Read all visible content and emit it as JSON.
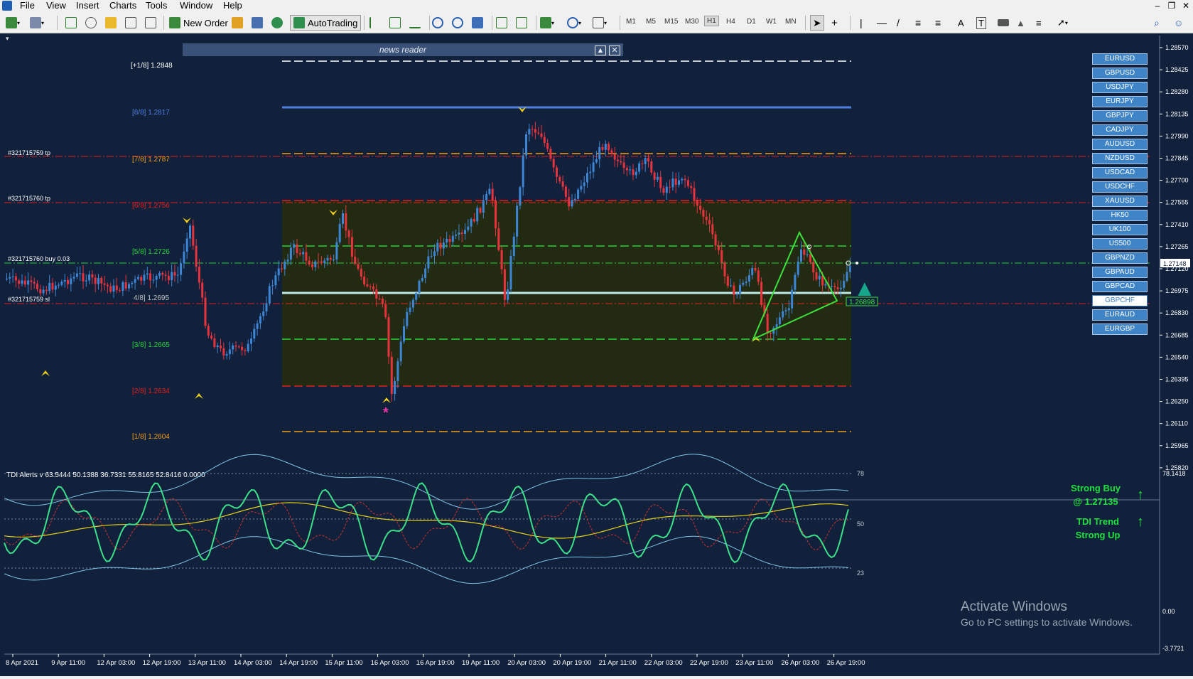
{
  "menu": [
    "File",
    "View",
    "Insert",
    "Charts",
    "Tools",
    "Window",
    "Help"
  ],
  "toolbar": {
    "new_order": "New Order",
    "autotrading": "AutoTrading"
  },
  "timeframes": [
    "M1",
    "M5",
    "M15",
    "M30",
    "H1",
    "H4",
    "D1",
    "W1",
    "MN"
  ],
  "active_timeframe": "H1",
  "news_reader": {
    "title": "news reader"
  },
  "price_axis": [
    "1.28570",
    "1.28425",
    "1.28280",
    "1.28135",
    "1.27990",
    "1.27845",
    "1.27700",
    "1.27555",
    "1.27410",
    "1.27265",
    "1.27120",
    "1.26975",
    "1.26830",
    "1.26685",
    "1.26540",
    "1.26395",
    "1.26250",
    "1.26110",
    "1.25965",
    "1.25820"
  ],
  "current_price": "1.27148",
  "murrey_levels": [
    {
      "label": "[+1/8]",
      "value": "1.2848",
      "color": "#ffffff"
    },
    {
      "label": "[8/8]",
      "value": "1.2817",
      "color": "#4e7fe0"
    },
    {
      "label": "[7/8]",
      "value": "1.2787",
      "color": "#f29d1c"
    },
    {
      "label": "[6/8]",
      "value": "1.2756",
      "color": "#e02020"
    },
    {
      "label": "[5/8]",
      "value": "1.2726",
      "color": "#26d13a"
    },
    {
      "label": "4/8]",
      "value": "1.2695",
      "color": "#c0c0c0"
    },
    {
      "label": "[3/8]",
      "value": "1.2665",
      "color": "#26d13a"
    },
    {
      "label": "[2/8]",
      "value": "1.2634",
      "color": "#e02020"
    },
    {
      "label": "[1/8]",
      "value": "1.2604",
      "color": "#f29d1c"
    }
  ],
  "order_labels": [
    "#321715759 tp",
    "#321715760 tp",
    "#321715760 buy 0.03",
    "#321715759 sl"
  ],
  "pattern_label": "1.26898",
  "symbols": [
    "EURUSD",
    "GBPUSD",
    "USDJPY",
    "EURJPY",
    "GBPJPY",
    "CADJPY",
    "AUDUSD",
    "NZDUSD",
    "USDCAD",
    "USDCHF",
    "XAUUSD",
    "HK50",
    "UK100",
    "US500",
    "GBPNZD",
    "GBPAUD",
    "GBPCAD",
    "GBPCHF",
    "EURAUD",
    "EURGBP"
  ],
  "active_symbol": "GBPCHF",
  "indicator": {
    "label": "TDI Alerts v 63.5444 50.1388 36.7331 55.8165 52.8416 0.0000",
    "axis_top": "78.1418",
    "axis_bottom": "-3.7721",
    "levels": [
      "78",
      "50",
      "23"
    ],
    "signal1_l1": "Strong Buy",
    "signal1_l2": "@ 1.27135",
    "signal2_l1": "TDI Trend",
    "signal2_l2": "Strong Up",
    "right_value": "0.00"
  },
  "time_axis": [
    "8 Apr 2021",
    "9 Apr 11:00",
    "12 Apr 03:00",
    "12 Apr 19:00",
    "13 Apr 11:00",
    "14 Apr 03:00",
    "14 Apr 19:00",
    "15 Apr 11:00",
    "16 Apr 03:00",
    "16 Apr 19:00",
    "19 Apr 11:00",
    "20 Apr 03:00",
    "20 Apr 19:00",
    "21 Apr 11:00",
    "22 Apr 03:00",
    "22 Apr 19:00",
    "23 Apr 11:00",
    "26 Apr 03:00",
    "26 Apr 19:00"
  ],
  "watermark": {
    "line1": "Activate Windows",
    "line2": "Go to PC settings to activate Windows."
  },
  "star_marker": "*",
  "up_arrow": "↑",
  "buy_arrow": "▲"
}
